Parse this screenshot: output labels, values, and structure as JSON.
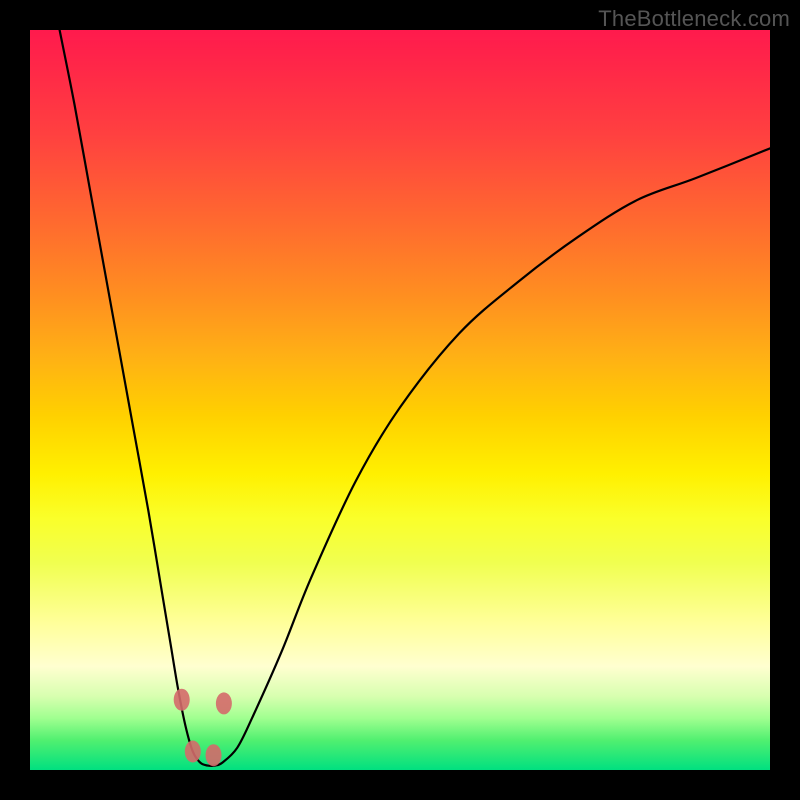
{
  "watermark": "TheBottleneck.com",
  "chart_data": {
    "type": "line",
    "title": "",
    "xlabel": "",
    "ylabel": "",
    "xlim": [
      0,
      100
    ],
    "ylim": [
      0,
      100
    ],
    "series": [
      {
        "name": "bottleneck-curve",
        "x": [
          4,
          6,
          8,
          10,
          12,
          14,
          16,
          18,
          19,
          20,
          21,
          22,
          23,
          24,
          25,
          26,
          28,
          30,
          34,
          38,
          44,
          50,
          58,
          66,
          74,
          82,
          90,
          100
        ],
        "values": [
          100,
          90,
          79,
          68,
          57,
          46,
          35,
          23,
          17,
          11,
          6,
          2.5,
          1,
          0.6,
          0.6,
          1,
          3,
          7,
          16,
          26,
          39,
          49,
          59,
          66,
          72,
          77,
          80,
          84
        ]
      }
    ],
    "markers": [
      {
        "x": 20.5,
        "y": 9.5,
        "label": "marker-left-upper"
      },
      {
        "x": 22.0,
        "y": 2.5,
        "label": "marker-left-lower"
      },
      {
        "x": 24.8,
        "y": 2.0,
        "label": "marker-right-lower"
      },
      {
        "x": 26.2,
        "y": 9.0,
        "label": "marker-right-upper"
      }
    ],
    "gradient_stops": [
      {
        "pos": 0,
        "color": "#ff1a4d"
      },
      {
        "pos": 26,
        "color": "#ff6a2f"
      },
      {
        "pos": 52,
        "color": "#ffd000"
      },
      {
        "pos": 80,
        "color": "#ffff99"
      },
      {
        "pos": 100,
        "color": "#00e080"
      }
    ]
  }
}
